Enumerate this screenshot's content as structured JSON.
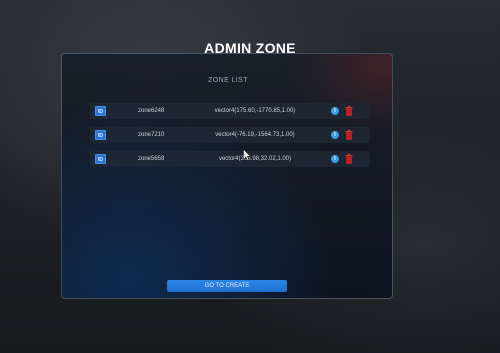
{
  "header": {
    "title": "ADMIN ZONE"
  },
  "zone_list": {
    "title": "ZONE LIST",
    "rows": [
      {
        "id_label": "ID",
        "name": "zone6248",
        "vector": "vector4(175.60,-1770.85,1.00)"
      },
      {
        "id_label": "ID",
        "name": "zone7210",
        "vector": "vector4(-76.19,-1564.73,1.00)"
      },
      {
        "id_label": "ID",
        "name": "zone5658",
        "vector": "vector4(363.98,32.02,1.00)"
      }
    ]
  },
  "actions": {
    "create_label": "GO TO CREATE"
  },
  "icons": {
    "info": "info-icon",
    "delete": "trash-icon"
  },
  "colors": {
    "accent": "#2f74d0",
    "info": "#3a9be8",
    "delete": "#d42424",
    "button": "#1e6fd0"
  }
}
